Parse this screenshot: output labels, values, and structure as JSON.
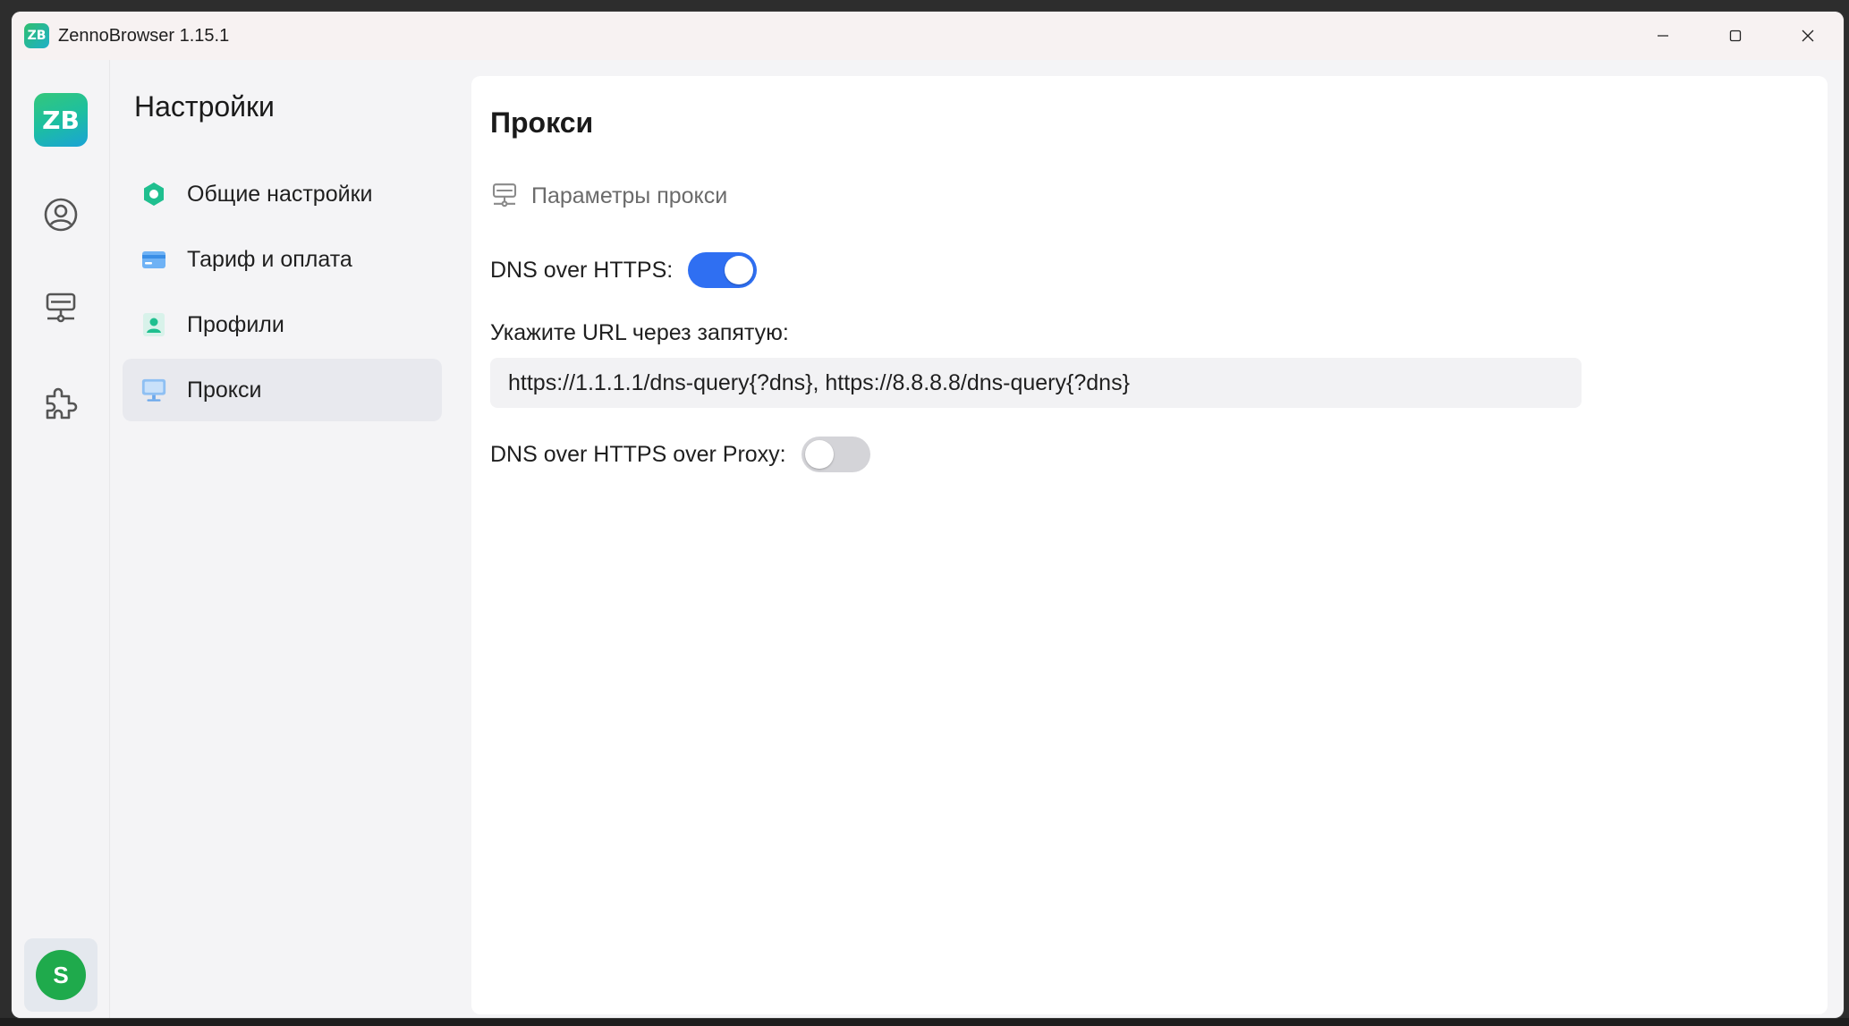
{
  "window": {
    "app_icon_text": "ZB",
    "title": "ZennoBrowser 1.15.1",
    "controls": [
      "minimize",
      "maximize",
      "close"
    ]
  },
  "rail": {
    "logo_text": "ZB",
    "items": [
      {
        "icon": "user-circle-icon"
      },
      {
        "icon": "proxy-server-icon"
      },
      {
        "icon": "puzzle-extension-icon"
      }
    ],
    "avatar_letter": "S",
    "avatar_color": "#1faa4c"
  },
  "settings_nav": {
    "title": "Настройки",
    "items": [
      {
        "label": "Общие настройки",
        "icon": "general-settings-icon",
        "active": false
      },
      {
        "label": "Тариф и оплата",
        "icon": "credit-card-icon",
        "active": false
      },
      {
        "label": "Профили",
        "icon": "profile-card-icon",
        "active": false
      },
      {
        "label": "Прокси",
        "icon": "monitor-icon",
        "active": true
      }
    ]
  },
  "content": {
    "title": "Прокси",
    "section_label": "Параметры прокси",
    "doh": {
      "label": "DNS over HTTPS:",
      "enabled": true
    },
    "url_label": "Укажите URL через запятую:",
    "url_value": "https://1.1.1.1/dns-query{?dns}, https://8.8.8.8/dns-query{?dns}",
    "doh_proxy": {
      "label": "DNS over HTTPS over Proxy:",
      "enabled": false
    }
  },
  "colors": {
    "accent": "#2f6ff2",
    "brand_green": "#2fbf6f",
    "brand_cyan": "#1aa3d6"
  }
}
